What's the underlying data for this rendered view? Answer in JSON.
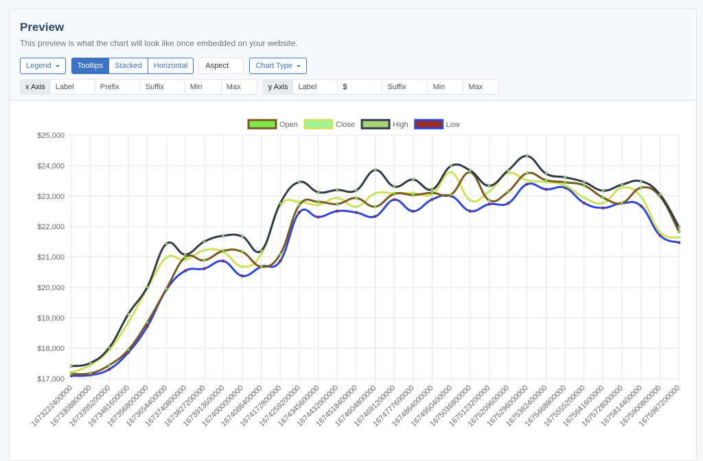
{
  "header": {
    "title": "Preview",
    "subtitle": "This preview is what the chart will look like once embedded on your website."
  },
  "toolbar": {
    "legend_label": "Legend",
    "toggle_buttons": [
      {
        "label": "Tooltips",
        "active": true
      },
      {
        "label": "Stacked",
        "active": false
      },
      {
        "label": "Horizontal",
        "active": false
      }
    ],
    "aspect_placeholder": "Aspect",
    "chart_type_label": "Chart Type"
  },
  "x_axis": {
    "addon": "x Axis",
    "label_placeholder": "Label",
    "prefix_placeholder": "Prefix",
    "prefix_value": "",
    "suffix_placeholder": "Suffix",
    "min_placeholder": "Min",
    "max_placeholder": "Max"
  },
  "y_axis": {
    "addon": "y Axis",
    "label_placeholder": "Label",
    "prefix_value": "$",
    "suffix_placeholder": "Suffix",
    "min_placeholder": "Min",
    "max_placeholder": "Max"
  },
  "chart_data": {
    "type": "line",
    "title": "",
    "xlabel": "",
    "ylabel": "",
    "ylim": [
      17000,
      25000
    ],
    "y_ticks": [
      "$17,000",
      "$18,000",
      "$19,000",
      "$20,000",
      "$21,000",
      "$22,000",
      "$23,000",
      "$24,000",
      "$25,000"
    ],
    "y_tick_values": [
      17000,
      18000,
      19000,
      20000,
      21000,
      22000,
      23000,
      24000,
      25000
    ],
    "grid": true,
    "legend_position": "top",
    "categories": [
      "1673222400000",
      "1673308800000",
      "1673395200000",
      "1673481600000",
      "1673568000000",
      "1673654400000",
      "1673740800000",
      "1673827200000",
      "1673913600000",
      "1674000000000",
      "1674086400000",
      "1674172800000",
      "1674259200000",
      "1674345600000",
      "1674432000000",
      "1674518400000",
      "1674604800000",
      "1674691200000",
      "1674777600000",
      "1674864000000",
      "1674950400000",
      "1675036800000",
      "1675123200000",
      "1675209600000",
      "1675296000000",
      "1675382400000",
      "1675468800000",
      "1675555200000",
      "1675641600000",
      "1675728000000",
      "1675814400000",
      "1675900800000",
      "1675987200000"
    ],
    "series": [
      {
        "name": "Open",
        "stroke": "#7a5a22",
        "fill": "#7fe84a",
        "values": [
          17160,
          17175,
          17445,
          17950,
          18850,
          19945,
          20990,
          20890,
          21200,
          21165,
          20680,
          21090,
          22700,
          22810,
          22735,
          22935,
          22650,
          23070,
          23035,
          23105,
          23050,
          23780,
          22860,
          23140,
          23750,
          23520,
          23450,
          23350,
          22950,
          22770,
          23275,
          22990,
          21830
        ]
      },
      {
        "name": "Close",
        "stroke": "#d4e157",
        "fill": "#9cf79a",
        "values": [
          17200,
          17450,
          17950,
          18855,
          19965,
          20975,
          20900,
          21220,
          21165,
          20680,
          21090,
          22690,
          22810,
          22710,
          22935,
          22650,
          23085,
          23085,
          23100,
          23060,
          23780,
          22860,
          23145,
          23750,
          23515,
          23460,
          23350,
          22950,
          22770,
          23275,
          22975,
          21810,
          21640
        ]
      },
      {
        "name": "High",
        "stroke": "#2f3a48",
        "fill": "#a8d47a",
        "values": [
          17410,
          17515,
          18025,
          19125,
          20015,
          21430,
          21080,
          21505,
          21695,
          21670,
          21205,
          22765,
          23460,
          23125,
          23200,
          23185,
          23855,
          23310,
          23540,
          23215,
          23990,
          23840,
          23335,
          23840,
          24315,
          23735,
          23615,
          23460,
          23175,
          23375,
          23485,
          23050,
          21980
        ]
      },
      {
        "name": "Low",
        "stroke": "#2d46e0",
        "fill": "#9b2b1e",
        "values": [
          17095,
          17120,
          17310,
          17865,
          18715,
          19920,
          20545,
          20615,
          20865,
          20375,
          20680,
          20865,
          22460,
          22310,
          22505,
          22460,
          22330,
          22880,
          22500,
          22890,
          23000,
          22505,
          22735,
          22760,
          23390,
          23220,
          23275,
          22770,
          22610,
          22765,
          22675,
          21705,
          21470
        ]
      }
    ]
  }
}
